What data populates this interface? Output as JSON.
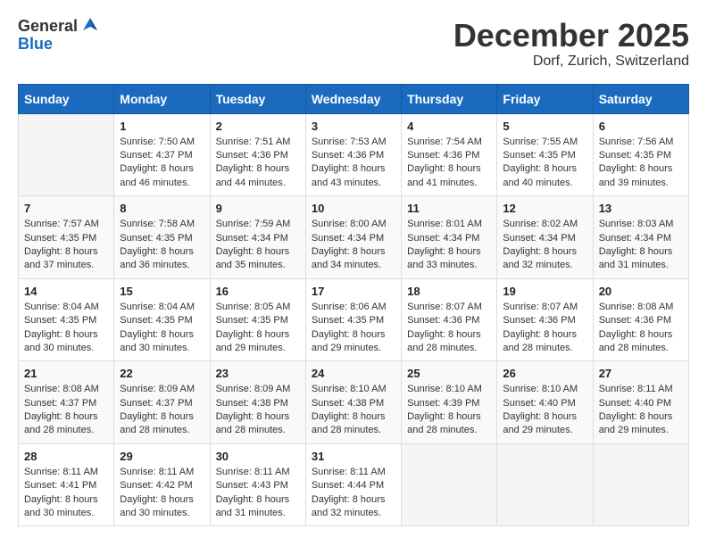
{
  "header": {
    "logo_general": "General",
    "logo_blue": "Blue",
    "month_title": "December 2025",
    "location": "Dorf, Zurich, Switzerland"
  },
  "weekdays": [
    "Sunday",
    "Monday",
    "Tuesday",
    "Wednesday",
    "Thursday",
    "Friday",
    "Saturday"
  ],
  "weeks": [
    [
      {
        "day": "",
        "sunrise": "",
        "sunset": "",
        "daylight": ""
      },
      {
        "day": "1",
        "sunrise": "Sunrise: 7:50 AM",
        "sunset": "Sunset: 4:37 PM",
        "daylight": "Daylight: 8 hours and 46 minutes."
      },
      {
        "day": "2",
        "sunrise": "Sunrise: 7:51 AM",
        "sunset": "Sunset: 4:36 PM",
        "daylight": "Daylight: 8 hours and 44 minutes."
      },
      {
        "day": "3",
        "sunrise": "Sunrise: 7:53 AM",
        "sunset": "Sunset: 4:36 PM",
        "daylight": "Daylight: 8 hours and 43 minutes."
      },
      {
        "day": "4",
        "sunrise": "Sunrise: 7:54 AM",
        "sunset": "Sunset: 4:36 PM",
        "daylight": "Daylight: 8 hours and 41 minutes."
      },
      {
        "day": "5",
        "sunrise": "Sunrise: 7:55 AM",
        "sunset": "Sunset: 4:35 PM",
        "daylight": "Daylight: 8 hours and 40 minutes."
      },
      {
        "day": "6",
        "sunrise": "Sunrise: 7:56 AM",
        "sunset": "Sunset: 4:35 PM",
        "daylight": "Daylight: 8 hours and 39 minutes."
      }
    ],
    [
      {
        "day": "7",
        "sunrise": "Sunrise: 7:57 AM",
        "sunset": "Sunset: 4:35 PM",
        "daylight": "Daylight: 8 hours and 37 minutes."
      },
      {
        "day": "8",
        "sunrise": "Sunrise: 7:58 AM",
        "sunset": "Sunset: 4:35 PM",
        "daylight": "Daylight: 8 hours and 36 minutes."
      },
      {
        "day": "9",
        "sunrise": "Sunrise: 7:59 AM",
        "sunset": "Sunset: 4:34 PM",
        "daylight": "Daylight: 8 hours and 35 minutes."
      },
      {
        "day": "10",
        "sunrise": "Sunrise: 8:00 AM",
        "sunset": "Sunset: 4:34 PM",
        "daylight": "Daylight: 8 hours and 34 minutes."
      },
      {
        "day": "11",
        "sunrise": "Sunrise: 8:01 AM",
        "sunset": "Sunset: 4:34 PM",
        "daylight": "Daylight: 8 hours and 33 minutes."
      },
      {
        "day": "12",
        "sunrise": "Sunrise: 8:02 AM",
        "sunset": "Sunset: 4:34 PM",
        "daylight": "Daylight: 8 hours and 32 minutes."
      },
      {
        "day": "13",
        "sunrise": "Sunrise: 8:03 AM",
        "sunset": "Sunset: 4:34 PM",
        "daylight": "Daylight: 8 hours and 31 minutes."
      }
    ],
    [
      {
        "day": "14",
        "sunrise": "Sunrise: 8:04 AM",
        "sunset": "Sunset: 4:35 PM",
        "daylight": "Daylight: 8 hours and 30 minutes."
      },
      {
        "day": "15",
        "sunrise": "Sunrise: 8:04 AM",
        "sunset": "Sunset: 4:35 PM",
        "daylight": "Daylight: 8 hours and 30 minutes."
      },
      {
        "day": "16",
        "sunrise": "Sunrise: 8:05 AM",
        "sunset": "Sunset: 4:35 PM",
        "daylight": "Daylight: 8 hours and 29 minutes."
      },
      {
        "day": "17",
        "sunrise": "Sunrise: 8:06 AM",
        "sunset": "Sunset: 4:35 PM",
        "daylight": "Daylight: 8 hours and 29 minutes."
      },
      {
        "day": "18",
        "sunrise": "Sunrise: 8:07 AM",
        "sunset": "Sunset: 4:36 PM",
        "daylight": "Daylight: 8 hours and 28 minutes."
      },
      {
        "day": "19",
        "sunrise": "Sunrise: 8:07 AM",
        "sunset": "Sunset: 4:36 PM",
        "daylight": "Daylight: 8 hours and 28 minutes."
      },
      {
        "day": "20",
        "sunrise": "Sunrise: 8:08 AM",
        "sunset": "Sunset: 4:36 PM",
        "daylight": "Daylight: 8 hours and 28 minutes."
      }
    ],
    [
      {
        "day": "21",
        "sunrise": "Sunrise: 8:08 AM",
        "sunset": "Sunset: 4:37 PM",
        "daylight": "Daylight: 8 hours and 28 minutes."
      },
      {
        "day": "22",
        "sunrise": "Sunrise: 8:09 AM",
        "sunset": "Sunset: 4:37 PM",
        "daylight": "Daylight: 8 hours and 28 minutes."
      },
      {
        "day": "23",
        "sunrise": "Sunrise: 8:09 AM",
        "sunset": "Sunset: 4:38 PM",
        "daylight": "Daylight: 8 hours and 28 minutes."
      },
      {
        "day": "24",
        "sunrise": "Sunrise: 8:10 AM",
        "sunset": "Sunset: 4:38 PM",
        "daylight": "Daylight: 8 hours and 28 minutes."
      },
      {
        "day": "25",
        "sunrise": "Sunrise: 8:10 AM",
        "sunset": "Sunset: 4:39 PM",
        "daylight": "Daylight: 8 hours and 28 minutes."
      },
      {
        "day": "26",
        "sunrise": "Sunrise: 8:10 AM",
        "sunset": "Sunset: 4:40 PM",
        "daylight": "Daylight: 8 hours and 29 minutes."
      },
      {
        "day": "27",
        "sunrise": "Sunrise: 8:11 AM",
        "sunset": "Sunset: 4:40 PM",
        "daylight": "Daylight: 8 hours and 29 minutes."
      }
    ],
    [
      {
        "day": "28",
        "sunrise": "Sunrise: 8:11 AM",
        "sunset": "Sunset: 4:41 PM",
        "daylight": "Daylight: 8 hours and 30 minutes."
      },
      {
        "day": "29",
        "sunrise": "Sunrise: 8:11 AM",
        "sunset": "Sunset: 4:42 PM",
        "daylight": "Daylight: 8 hours and 30 minutes."
      },
      {
        "day": "30",
        "sunrise": "Sunrise: 8:11 AM",
        "sunset": "Sunset: 4:43 PM",
        "daylight": "Daylight: 8 hours and 31 minutes."
      },
      {
        "day": "31",
        "sunrise": "Sunrise: 8:11 AM",
        "sunset": "Sunset: 4:44 PM",
        "daylight": "Daylight: 8 hours and 32 minutes."
      },
      {
        "day": "",
        "sunrise": "",
        "sunset": "",
        "daylight": ""
      },
      {
        "day": "",
        "sunrise": "",
        "sunset": "",
        "daylight": ""
      },
      {
        "day": "",
        "sunrise": "",
        "sunset": "",
        "daylight": ""
      }
    ]
  ]
}
